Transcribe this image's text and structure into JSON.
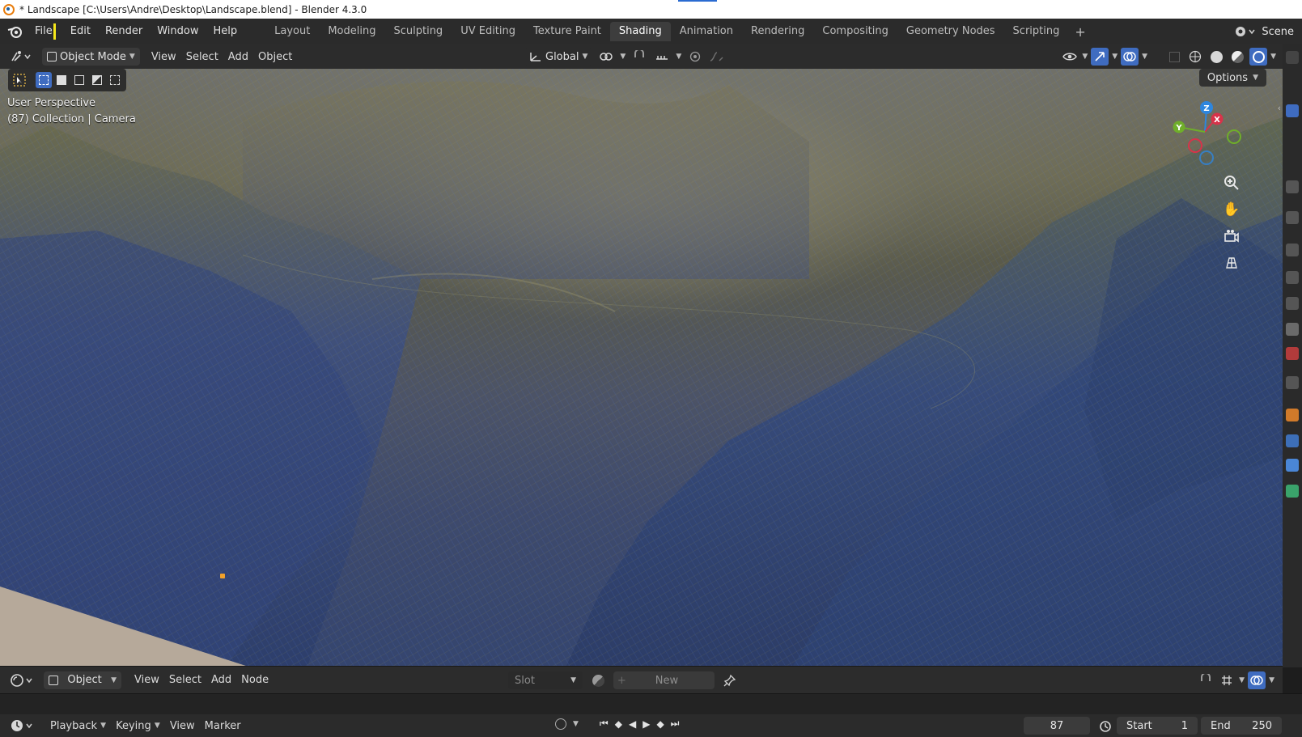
{
  "window": {
    "title": "* Landscape [C:\\Users\\Andre\\Desktop\\Landscape.blend] - Blender 4.3.0"
  },
  "topbar": {
    "menus": [
      "File",
      "Edit",
      "Render",
      "Window",
      "Help"
    ],
    "workspaces": [
      "Layout",
      "Modeling",
      "Sculpting",
      "UV Editing",
      "Texture Paint",
      "Shading",
      "Animation",
      "Rendering",
      "Compositing",
      "Geometry Nodes",
      "Scripting"
    ],
    "active_workspace": "Shading",
    "add_workspace": "+",
    "scene_label": "Scene"
  },
  "viewport_header": {
    "mode": "Object Mode",
    "menus": [
      "View",
      "Select",
      "Add",
      "Object"
    ],
    "orientation": "Global"
  },
  "viewport": {
    "perspective_label": "User Perspective",
    "collection_label": "(87) Collection | Camera",
    "options_label": "Options",
    "gizmo": {
      "z": "Z",
      "x": "X",
      "y": "Y"
    }
  },
  "shader_editor": {
    "object_dropdown": "Object",
    "menus": [
      "View",
      "Select",
      "Add",
      "Node"
    ],
    "slot_label": "Slot",
    "new_label": "New"
  },
  "timeline": {
    "menus": [
      "Playback",
      "Keying",
      "View",
      "Marker"
    ],
    "current_frame": "87",
    "start_label": "Start",
    "start_value": "1",
    "end_label": "End",
    "end_value": "250"
  },
  "colors": {
    "active_tab_bg": "#3d3d3d",
    "accent_blue": "#3f6cc0",
    "cursor_yellow": "#f6e71a",
    "gizmo_x": "#d7334a",
    "gizmo_y": "#6fae2a",
    "gizmo_z": "#2e86de"
  }
}
